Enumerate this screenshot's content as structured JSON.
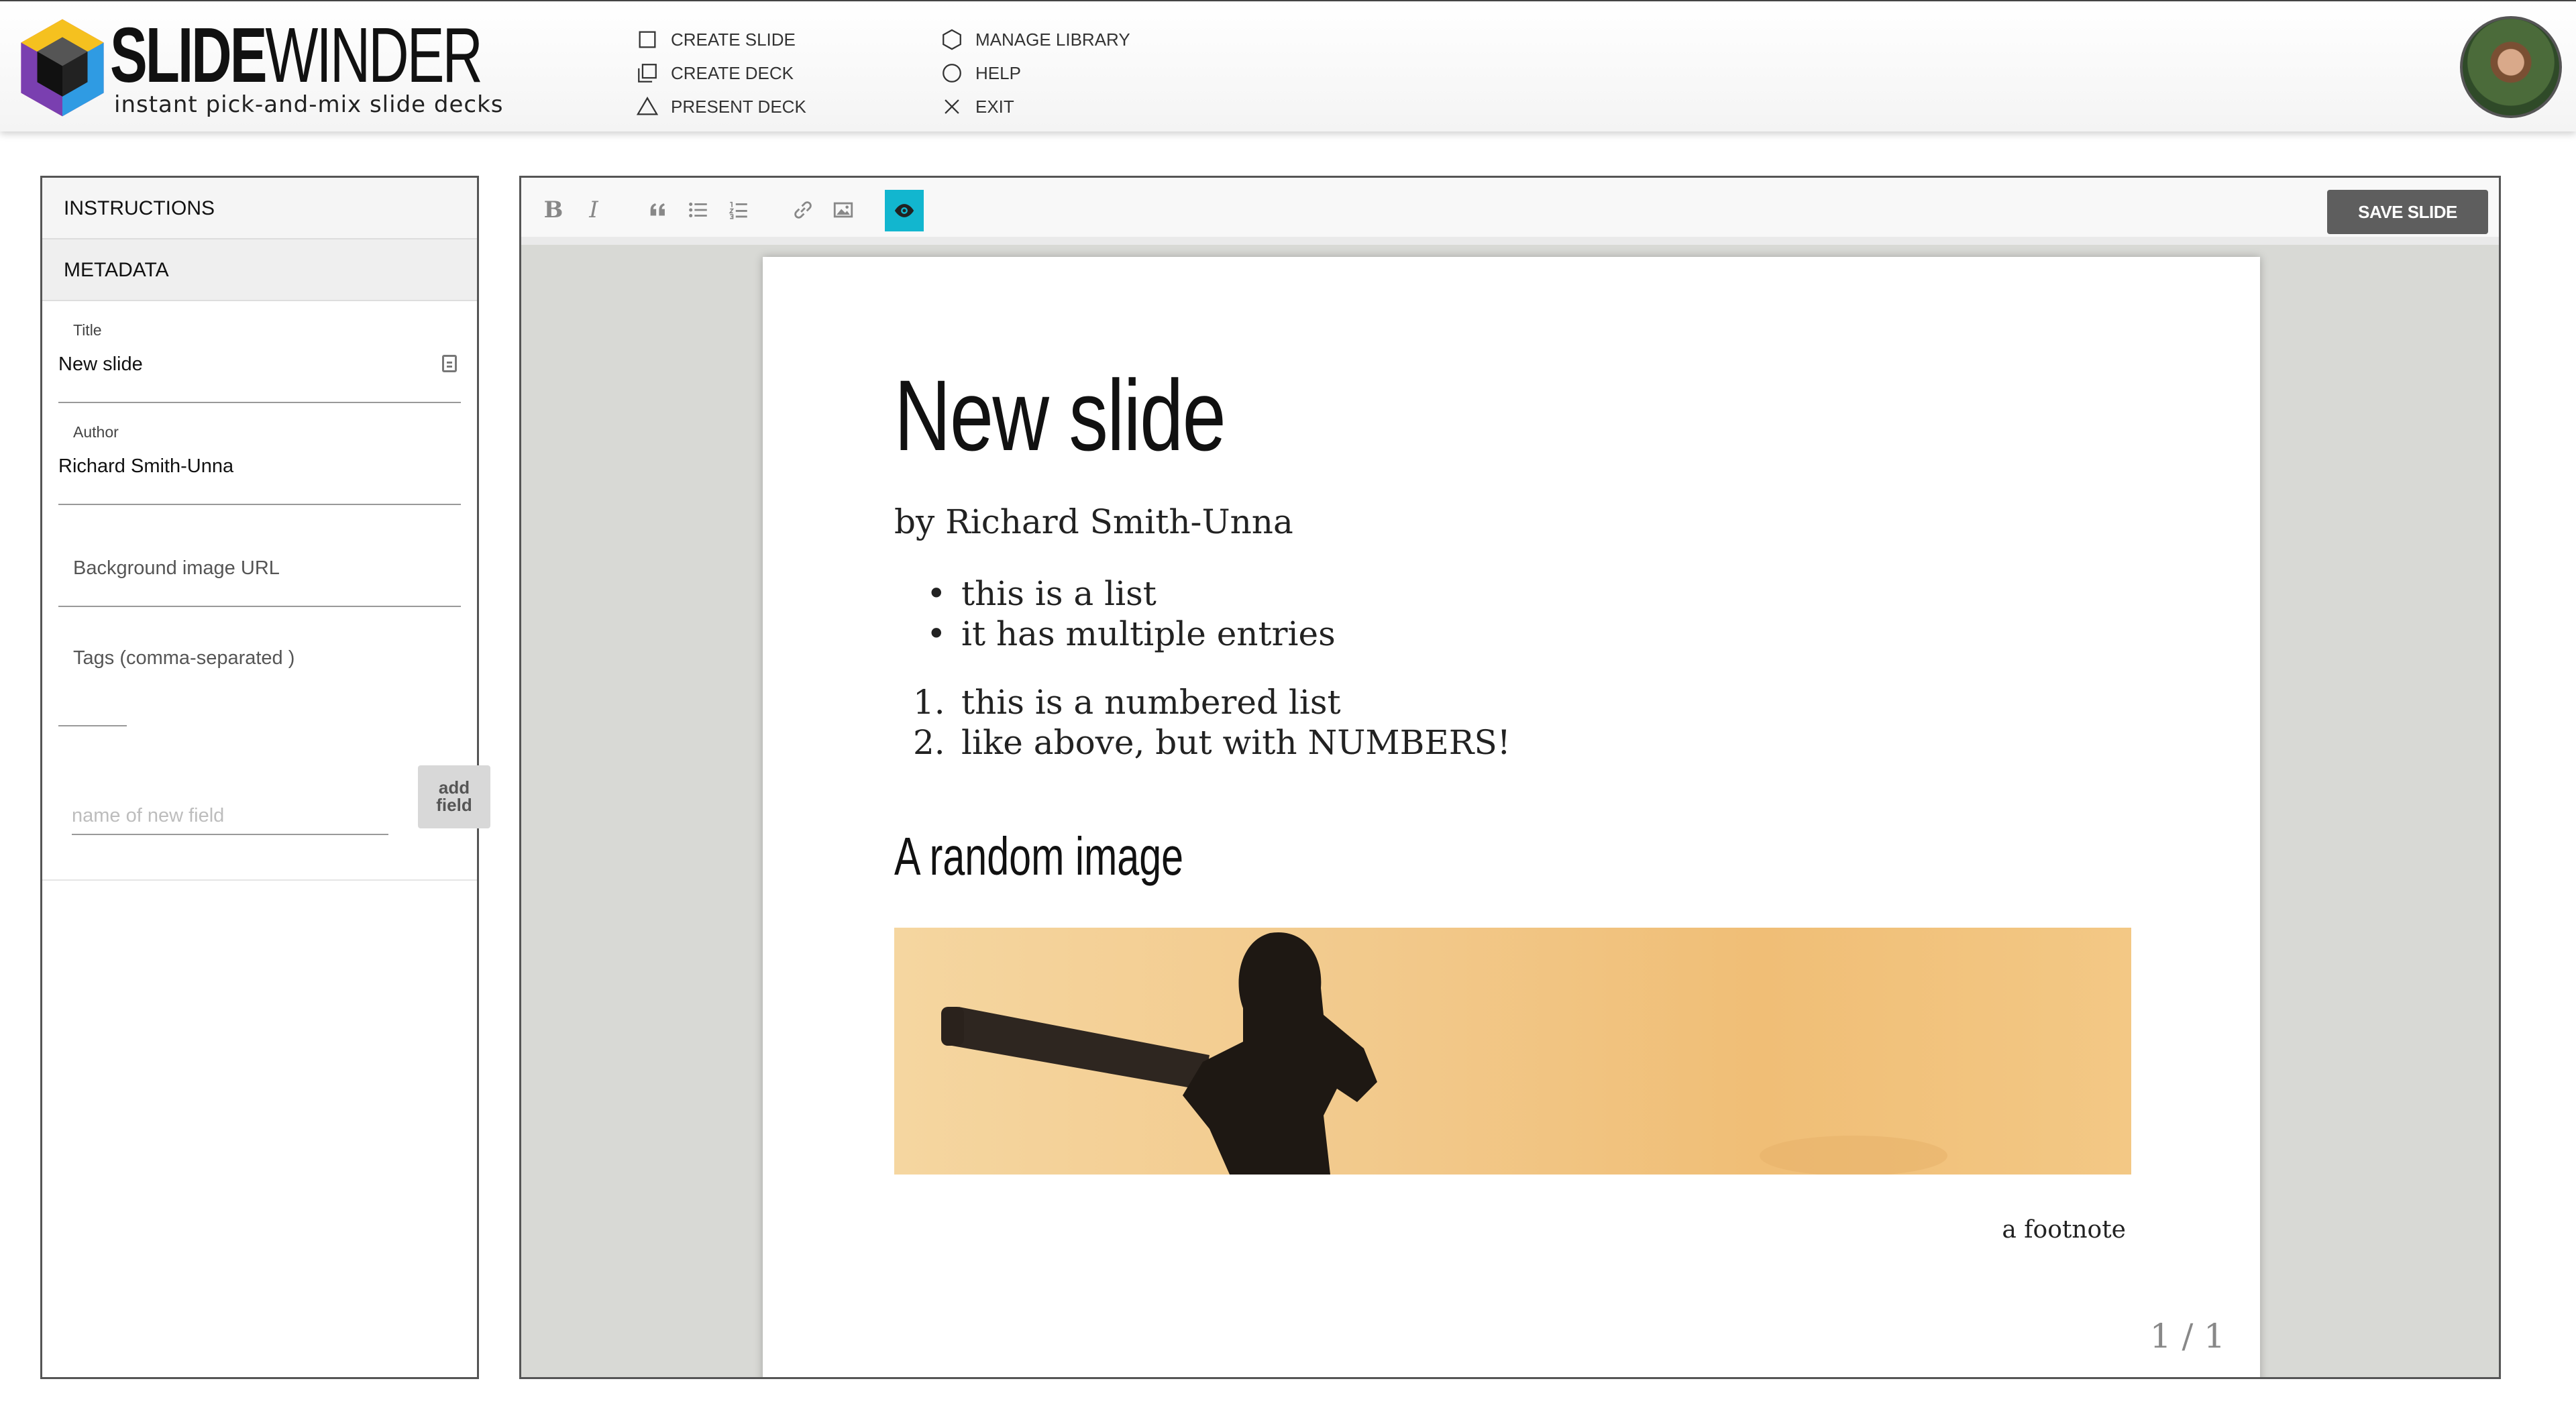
{
  "app": {
    "logo_bold": "SLIDE",
    "logo_light": "WINDER",
    "tagline": "instant pick-and-mix slide decks"
  },
  "menu": {
    "col1": [
      {
        "label": "CREATE SLIDE",
        "icon": "square-icon"
      },
      {
        "label": "CREATE DECK",
        "icon": "stacked-squares-icon"
      },
      {
        "label": "PRESENT DECK",
        "icon": "triangle-icon"
      }
    ],
    "col2": [
      {
        "label": "MANAGE LIBRARY",
        "icon": "hexagon-icon"
      },
      {
        "label": "HELP",
        "icon": "circle-icon"
      },
      {
        "label": "EXIT",
        "icon": "x-icon"
      }
    ]
  },
  "sidebar": {
    "instructions_tab": "INSTRUCTIONS",
    "metadata_tab": "METADATA",
    "title_label": "Title",
    "title_value": "New slide",
    "author_label": "Author",
    "author_value": "Richard Smith-Unna",
    "background_placeholder": "Background image URL",
    "tags_placeholder": "Tags (comma-separated )",
    "new_field_placeholder": "name of new field",
    "add_field_label_line1": "add",
    "add_field_label_line2": "field"
  },
  "toolbar": {
    "bold": "B",
    "italic": "I",
    "save_label": "SAVE SLIDE",
    "active_color": "#12b6cf"
  },
  "slide": {
    "title": "New slide",
    "byline": "by Richard Smith-Unna",
    "bullets": [
      "this is a list",
      "it has multiple entries"
    ],
    "numbered": [
      "this is a numbered list",
      "like above, but with NUMBERS!"
    ],
    "numbered_markers": [
      "1.",
      "2."
    ],
    "subheading": "A random image",
    "footnote": "a footnote",
    "pager": "1 / 1"
  }
}
